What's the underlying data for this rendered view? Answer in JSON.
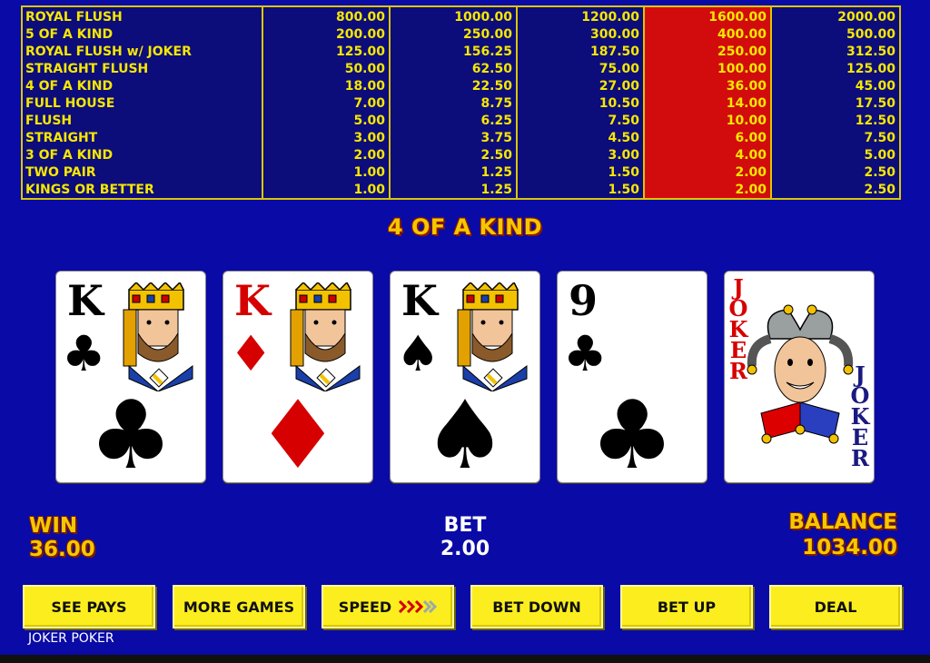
{
  "paytable": {
    "hands": [
      "ROYAL FLUSH",
      "5 OF A KIND",
      "ROYAL FLUSH w/ JOKER",
      "STRAIGHT FLUSH",
      "4 OF A KIND",
      "FULL HOUSE",
      "FLUSH",
      "STRAIGHT",
      "3 OF A KIND",
      "TWO PAIR",
      "KINGS OR BETTER"
    ],
    "columns": [
      [
        "800.00",
        "200.00",
        "125.00",
        "50.00",
        "18.00",
        "7.00",
        "5.00",
        "3.00",
        "2.00",
        "1.00",
        "1.00"
      ],
      [
        "1000.00",
        "250.00",
        "156.25",
        "62.50",
        "22.50",
        "8.75",
        "6.25",
        "3.75",
        "2.50",
        "1.25",
        "1.25"
      ],
      [
        "1200.00",
        "300.00",
        "187.50",
        "75.00",
        "27.00",
        "10.50",
        "7.50",
        "4.50",
        "3.00",
        "1.50",
        "1.50"
      ],
      [
        "1600.00",
        "400.00",
        "250.00",
        "100.00",
        "36.00",
        "14.00",
        "10.00",
        "6.00",
        "4.00",
        "2.00",
        "2.00"
      ],
      [
        "2000.00",
        "500.00",
        "312.50",
        "125.00",
        "45.00",
        "17.50",
        "12.50",
        "7.50",
        "5.00",
        "2.50",
        "2.50"
      ]
    ],
    "active_column_index": 3,
    "highlight_color": "#d20c0c",
    "text_color": "#f6e700"
  },
  "result": "4 OF A KIND",
  "cards": [
    {
      "rank": "K",
      "suit": "♣",
      "color": "black",
      "face": "king-clubs"
    },
    {
      "rank": "K",
      "suit": "♦",
      "color": "red",
      "face": "king-diamonds"
    },
    {
      "rank": "K",
      "suit": "♠",
      "color": "black",
      "face": "king-spades"
    },
    {
      "rank": "9",
      "suit": "♣",
      "color": "black",
      "face": "none"
    },
    {
      "rank": "JOKER",
      "suit": "",
      "color": "joker",
      "face": "jester"
    }
  ],
  "joker_label": "JOKER",
  "win": {
    "label": "WIN",
    "value": "36.00"
  },
  "bet": {
    "label": "BET",
    "value": "2.00"
  },
  "balance": {
    "label": "BALANCE",
    "value": "1034.00"
  },
  "buttons": {
    "see_pays": "SEE PAYS",
    "more_games": "MORE GAMES",
    "speed": "SPEED",
    "bet_down": "BET DOWN",
    "bet_up": "BET UP",
    "deal": "DEAL"
  },
  "game_name": "JOKER POKER",
  "colors": {
    "background": "#0a0aa6",
    "button": "#fcee1e",
    "accent_yellow": "#f4c800"
  }
}
